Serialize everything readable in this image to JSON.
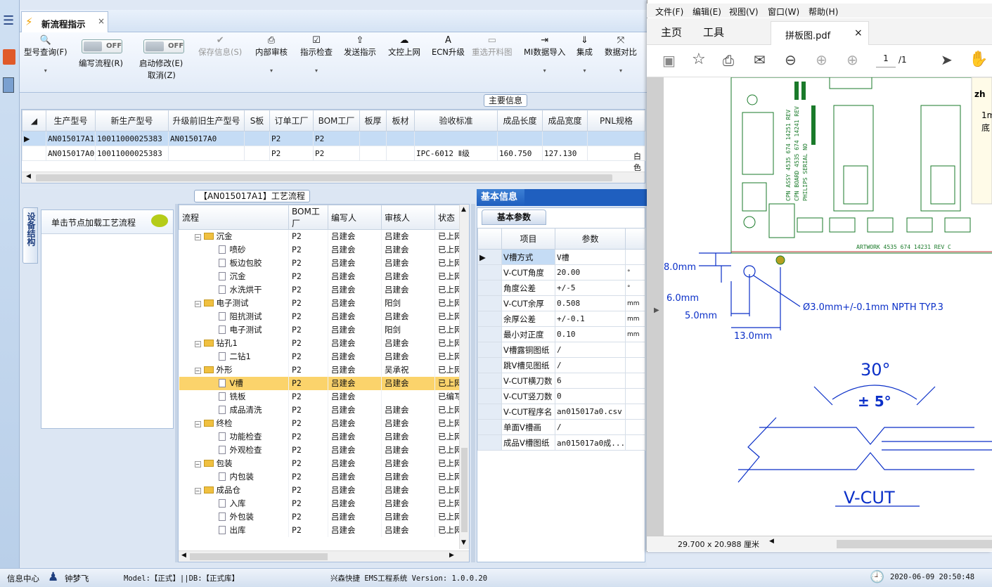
{
  "tab": {
    "title": "新流程指示",
    "close": "×"
  },
  "toolbar": {
    "query": "型号查询(F)",
    "write_flow": "编写流程(R)",
    "start_modify": "启动修改(E)",
    "cancel": "取消(Z)",
    "toggle_off": "OFF",
    "save_info": "保存信息(S)",
    "internal_review": "内部审核",
    "instr_check": "指示检查",
    "send_instr": "发送指示",
    "file_upload": "文控上网",
    "ecn_upgrade": "ECN升级",
    "reselect_image": "重选开料图",
    "mi_import": "MI数据导入",
    "integrate": "集成",
    "data_compare": "数据对比"
  },
  "main_info": {
    "title": "主要信息",
    "columns": [
      "生产型号",
      "新生产型号",
      "升级前旧生产型号",
      "S板",
      "订单工厂",
      "BOM工厂",
      "板厚",
      "板材",
      "验收标准",
      "成品长度",
      "成品宽度",
      "PNL规格"
    ],
    "rows": [
      [
        "AN015017A1",
        "10011000025383",
        "AN015017A0",
        "",
        "P2",
        "P2",
        "",
        "",
        "",
        "",
        "",
        ""
      ],
      [
        "AN015017A0",
        "10011000025383",
        "",
        "",
        "P2",
        "P2",
        "",
        "",
        "IPC-6012 Ⅱ级",
        "160.750",
        "127.130",
        ""
      ]
    ],
    "overflow_text": "白色"
  },
  "device": {
    "tab_label": "设备结构",
    "hint": "单击节点加载工艺流程"
  },
  "flow": {
    "title": "【AN015017A1】工艺流程",
    "columns": [
      "流程",
      "BOM工厂",
      "编写人",
      "审核人",
      "状态"
    ],
    "rows": [
      {
        "level": 0,
        "name": "沉金",
        "bom": "P2",
        "writer": "吕建会",
        "reviewer": "吕建会",
        "status": "已上网"
      },
      {
        "level": 1,
        "name": "喷砂",
        "bom": "P2",
        "writer": "吕建会",
        "reviewer": "吕建会",
        "status": "已上网"
      },
      {
        "level": 1,
        "name": "板边包胶",
        "bom": "P2",
        "writer": "吕建会",
        "reviewer": "吕建会",
        "status": "已上网"
      },
      {
        "level": 1,
        "name": "沉金",
        "bom": "P2",
        "writer": "吕建会",
        "reviewer": "吕建会",
        "status": "已上网"
      },
      {
        "level": 1,
        "name": "水洗烘干",
        "bom": "P2",
        "writer": "吕建会",
        "reviewer": "吕建会",
        "status": "已上网"
      },
      {
        "level": 0,
        "name": "电子测试",
        "bom": "P2",
        "writer": "吕建会",
        "reviewer": "阳剑",
        "status": "已上网"
      },
      {
        "level": 1,
        "name": "阻抗测试",
        "bom": "P2",
        "writer": "吕建会",
        "reviewer": "吕建会",
        "status": "已上网"
      },
      {
        "level": 1,
        "name": "电子测试",
        "bom": "P2",
        "writer": "吕建会",
        "reviewer": "阳剑",
        "status": "已上网"
      },
      {
        "level": 0,
        "name": "钻孔1",
        "bom": "P2",
        "writer": "吕建会",
        "reviewer": "吕建会",
        "status": "已上网"
      },
      {
        "level": 1,
        "name": "二钻1",
        "bom": "P2",
        "writer": "吕建会",
        "reviewer": "吕建会",
        "status": "已上网"
      },
      {
        "level": 0,
        "name": "外形",
        "bom": "P2",
        "writer": "吕建会",
        "reviewer": "吴承祝",
        "status": "已上网"
      },
      {
        "level": 1,
        "name": "V槽",
        "bom": "P2",
        "writer": "吕建会",
        "reviewer": "吕建会",
        "status": "已上网",
        "selected": true
      },
      {
        "level": 1,
        "name": "铣板",
        "bom": "P2",
        "writer": "吕建会",
        "reviewer": "",
        "status": "已编写"
      },
      {
        "level": 1,
        "name": "成品清洗",
        "bom": "P2",
        "writer": "吕建会",
        "reviewer": "吕建会",
        "status": "已上网"
      },
      {
        "level": 0,
        "name": "终检",
        "bom": "P2",
        "writer": "吕建会",
        "reviewer": "吕建会",
        "status": "已上网"
      },
      {
        "level": 1,
        "name": "功能检查",
        "bom": "P2",
        "writer": "吕建会",
        "reviewer": "吕建会",
        "status": "已上网"
      },
      {
        "level": 1,
        "name": "外观检查",
        "bom": "P2",
        "writer": "吕建会",
        "reviewer": "吕建会",
        "status": "已上网"
      },
      {
        "level": 0,
        "name": "包装",
        "bom": "P2",
        "writer": "吕建会",
        "reviewer": "吕建会",
        "status": "已上网"
      },
      {
        "level": 1,
        "name": "内包装",
        "bom": "P2",
        "writer": "吕建会",
        "reviewer": "吕建会",
        "status": "已上网"
      },
      {
        "level": 0,
        "name": "成品仓",
        "bom": "P2",
        "writer": "吕建会",
        "reviewer": "吕建会",
        "status": "已上网"
      },
      {
        "level": 1,
        "name": "入库",
        "bom": "P2",
        "writer": "吕建会",
        "reviewer": "吕建会",
        "status": "已上网"
      },
      {
        "level": 1,
        "name": "外包装",
        "bom": "P2",
        "writer": "吕建会",
        "reviewer": "吕建会",
        "status": "已上网"
      },
      {
        "level": 1,
        "name": "出库",
        "bom": "P2",
        "writer": "吕建会",
        "reviewer": "吕建会",
        "status": "已上网"
      }
    ]
  },
  "basic": {
    "title": "基本信息",
    "tab": "基本参数",
    "columns": [
      "项目",
      "参数"
    ],
    "rows": [
      {
        "item": "V槽方式",
        "value": "V槽",
        "unit": ""
      },
      {
        "item": "V-CUT角度",
        "value": "20.00",
        "unit": "°"
      },
      {
        "item": "角度公差",
        "value": "+/-5",
        "unit": "°"
      },
      {
        "item": "V-CUT余厚",
        "value": "0.508",
        "unit": "mm"
      },
      {
        "item": "余厚公差",
        "value": "+/-0.1",
        "unit": "mm"
      },
      {
        "item": "最小对正度",
        "value": "0.10",
        "unit": "mm"
      },
      {
        "item": "V槽露铜图纸",
        "value": "/",
        "unit": ""
      },
      {
        "item": "跳V槽见图纸",
        "value": "/",
        "unit": ""
      },
      {
        "item": "V-CUT横刀数",
        "value": "6",
        "unit": ""
      },
      {
        "item": "V-CUT竖刀数",
        "value": "0",
        "unit": ""
      },
      {
        "item": "V-CUT程序名",
        "value": "an015017a0.csv",
        "unit": ""
      },
      {
        "item": "单面V槽画",
        "value": "/",
        "unit": ""
      },
      {
        "item": "成品V槽图纸",
        "value": "an015017a0成...",
        "unit": ""
      }
    ]
  },
  "status": {
    "info_center": "信息中心",
    "user": "钟梦飞",
    "model": "Model:【正式】||DB:【正式库】",
    "system": "兴森快捷 EMS工程系统 Version: 1.0.0.20",
    "datetime": "2020-06-09 20:50:48"
  },
  "pdf": {
    "menu": [
      "文件(F)",
      "编辑(E)",
      "视图(V)",
      "窗口(W)",
      "帮助(H)"
    ],
    "tabs": [
      "主页",
      "工具"
    ],
    "doc_tab": "拼板图.pdf",
    "page_current": "1",
    "page_total": "/1",
    "page_size": "29.700 x 20.988 厘米",
    "drawing": {
      "dim_8": "8.0mm",
      "dim_6": "6.0mm",
      "dim_5": "5.0mm",
      "dim_13": "13.0mm",
      "hole": "Ø3.0mm+/-0.1mm NPTH TYP.3",
      "angle": "30°",
      "tol": "± 5°",
      "vcut": "V-CUT",
      "artwork": "ARTWORK 4535 674 14231 REV C",
      "pcb_v1": "CPN ASSY 4535 674 14251 REV",
      "pcb_v2": "CPN BOARD 4535 674 14241 REV",
      "pcb_v3": "PHILIPS SERIAL NO",
      "side1": "zh",
      "side2": "1m",
      "side3": "底"
    }
  },
  "colors": {
    "accent": "#1f5fbf",
    "selected_row": "#c5dcf5",
    "highlight": "#fbd36b",
    "drawing_blue": "#0a2fc8",
    "pcb_green": "#1a7a2a"
  }
}
